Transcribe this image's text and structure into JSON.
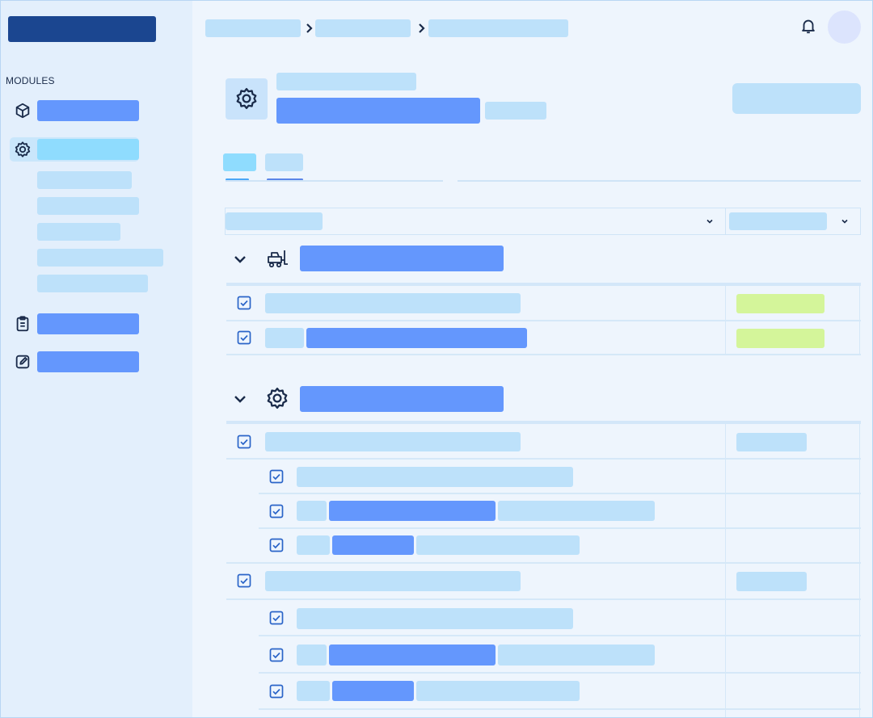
{
  "sidebar": {
    "section_label": "MODULES",
    "items": [
      {
        "icon": "cube-icon",
        "active": false
      },
      {
        "icon": "gear-icon",
        "active": true
      },
      {
        "icon": "clipboard-icon",
        "active": false
      },
      {
        "icon": "edit-icon",
        "active": false
      }
    ],
    "sub_items_count": 5
  },
  "header": {
    "icons": [
      "bell-icon",
      "avatar"
    ]
  },
  "page": {
    "icon": "gear-icon"
  },
  "groups": [
    {
      "icon": "forklift-icon",
      "status_color": "#d4f59a"
    },
    {
      "icon": "gear-icon",
      "status_color": "#bde1fa"
    }
  ],
  "colors": {
    "accent": "#6497fd",
    "accent_light": "#bde1fa",
    "active": "#8fdcfe",
    "brand": "#1b4690",
    "status_ok": "#d4f59a",
    "background": "#eef5fd",
    "sidebar": "#e3effc"
  }
}
